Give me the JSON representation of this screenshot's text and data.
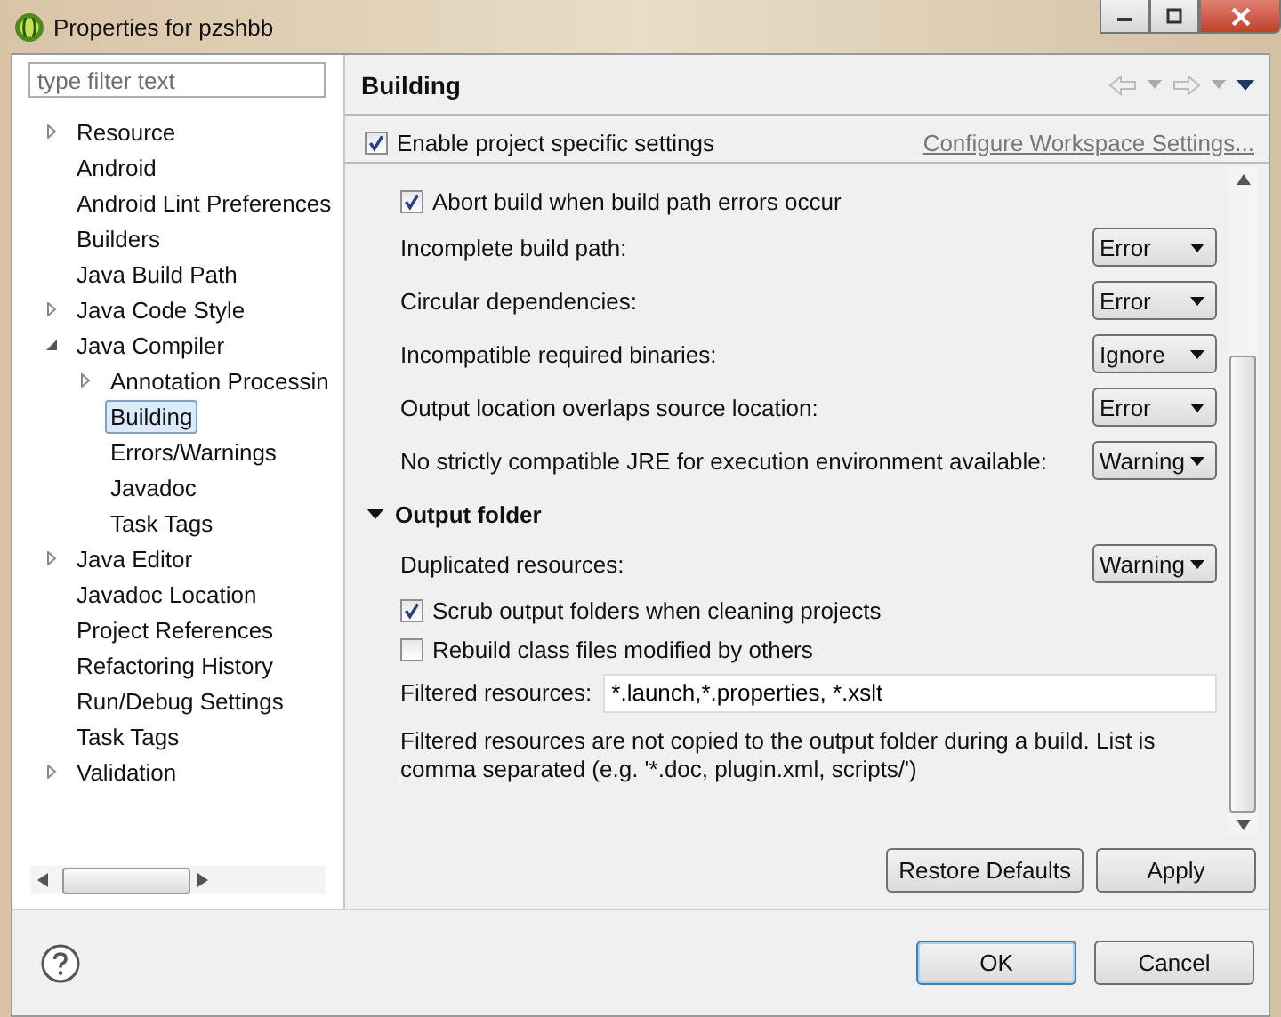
{
  "window": {
    "title": "Properties for pzshbb"
  },
  "sidebar": {
    "filter": {
      "placeholder": "type filter text"
    },
    "items": [
      {
        "label": "Resource",
        "expanded": false,
        "selected": false
      },
      {
        "label": "Android",
        "selected": false
      },
      {
        "label": "Android Lint Preferences",
        "selected": false
      },
      {
        "label": "Builders",
        "selected": false
      },
      {
        "label": "Java Build Path",
        "selected": false
      },
      {
        "label": "Java Code Style",
        "expanded": false,
        "selected": false
      },
      {
        "label": "Java Compiler",
        "expanded": true,
        "selected": false,
        "children": [
          {
            "label": "Annotation Processin",
            "expanded": false,
            "selected": false
          },
          {
            "label": "Building",
            "selected": true
          },
          {
            "label": "Errors/Warnings",
            "selected": false
          },
          {
            "label": "Javadoc",
            "selected": false
          },
          {
            "label": "Task Tags",
            "selected": false
          }
        ]
      },
      {
        "label": "Java Editor",
        "expanded": false,
        "selected": false
      },
      {
        "label": "Javadoc Location",
        "selected": false
      },
      {
        "label": "Project References",
        "selected": false
      },
      {
        "label": "Refactoring History",
        "selected": false
      },
      {
        "label": "Run/Debug Settings",
        "selected": false
      },
      {
        "label": "Task Tags",
        "selected": false
      },
      {
        "label": "Validation",
        "expanded": false,
        "selected": false
      }
    ]
  },
  "page": {
    "title": "Building",
    "enable": {
      "label": "Enable project specific settings",
      "checked": true
    },
    "workspace_link": "Configure Workspace Settings...",
    "sections": [
      {
        "rows": [
          {
            "kind": "checkbox",
            "label": "Abort build when build path errors occur",
            "checked": true
          },
          {
            "kind": "combo",
            "label": "Incomplete build path:",
            "value": "Error"
          },
          {
            "kind": "combo",
            "label": "Circular dependencies:",
            "value": "Error"
          },
          {
            "kind": "combo",
            "label": "Incompatible required binaries:",
            "value": "Ignore"
          },
          {
            "kind": "combo",
            "label": "Output location overlaps source location:",
            "value": "Error"
          },
          {
            "kind": "combo",
            "label": "No strictly compatible JRE for execution environment available:",
            "value": "Warning"
          }
        ]
      },
      {
        "title": "Output folder",
        "expanded": true,
        "rows": [
          {
            "kind": "combo",
            "label": "Duplicated resources:",
            "value": "Warning"
          },
          {
            "kind": "checkbox",
            "label": "Scrub output folders when cleaning projects",
            "checked": true
          },
          {
            "kind": "checkbox",
            "label": "Rebuild class files modified by others",
            "checked": false
          },
          {
            "kind": "text",
            "label": "Filtered resources:",
            "value": "*.launch,*.properties, *.xslt"
          },
          {
            "kind": "note",
            "label": "Filtered resources are not copied to the output folder during a build. List is comma separated (e.g. '*.doc, plugin.xml, scripts/')"
          }
        ]
      }
    ],
    "buttons": [
      "Restore Defaults",
      "Apply"
    ]
  },
  "footer_buttons": [
    "OK",
    "Cancel"
  ]
}
